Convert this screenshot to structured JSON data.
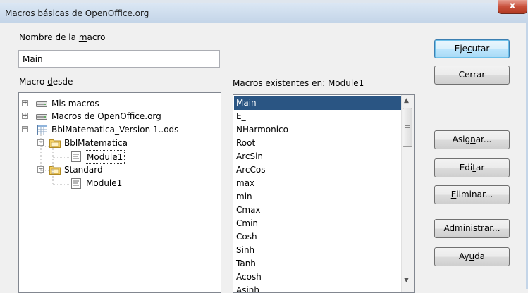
{
  "window": {
    "title": "Macros básicas de OpenOffice.org",
    "close_label": "x"
  },
  "macro_name": {
    "label_pre": "Nombre de la ",
    "label_u": "m",
    "label_post": "acro",
    "value": "Main"
  },
  "macro_from": {
    "label_pre": "Macro ",
    "label_u": "d",
    "label_post": "esde",
    "tree": [
      {
        "label": "Mis macros",
        "expander": "+"
      },
      {
        "label": "Macros de OpenOffice.org",
        "expander": "+"
      },
      {
        "label": "BblMatematica_Version 1..ods",
        "expander": "−"
      },
      {
        "label": "BblMatematica",
        "expander": "−"
      },
      {
        "label": "Module1"
      },
      {
        "label": "Standard",
        "expander": "−"
      },
      {
        "label": "Module1"
      }
    ]
  },
  "existing": {
    "label_pre": "Macros existentes ",
    "label_u": "e",
    "label_post": "n: Module1",
    "items": [
      "Main",
      "E_",
      "NHarmonico",
      "Root",
      "ArcSin",
      "ArcCos",
      "max",
      "min",
      "Cmax",
      "Cmin",
      "Cosh",
      "Sinh",
      "Tanh",
      "Acosh",
      "Asinh"
    ]
  },
  "buttons": {
    "run": {
      "pre": "Eje",
      "u": "c",
      "post": "utar"
    },
    "close": {
      "pre": "",
      "u": "",
      "post": "Cerrar"
    },
    "assign": {
      "pre": "Asig",
      "u": "n",
      "post": "ar..."
    },
    "edit": {
      "pre": "Edi",
      "u": "t",
      "post": "ar"
    },
    "delete": {
      "pre": "",
      "u": "E",
      "post": "liminar..."
    },
    "organize": {
      "pre": "",
      "u": "A",
      "post": "dministrar..."
    },
    "help": {
      "pre": "Ay",
      "u": "u",
      "post": "da"
    }
  },
  "colors": {
    "selection": "#2a5583",
    "default_button_border": "#3c7fb1"
  }
}
